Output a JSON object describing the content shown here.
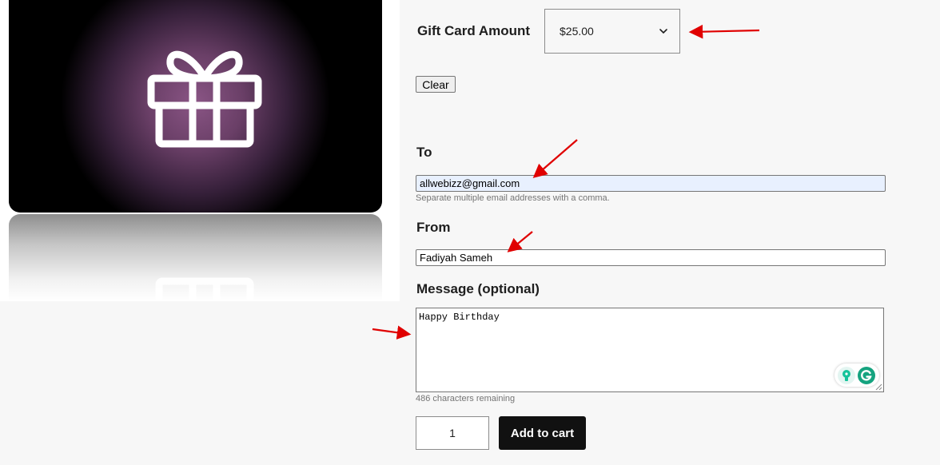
{
  "product_image": {
    "icon": "gift-icon",
    "colors": {
      "glow": "#8a5585",
      "background": "#000000"
    }
  },
  "amount": {
    "label": "Gift Card Amount",
    "selected": "$25.00",
    "clear_label": "Clear"
  },
  "to": {
    "label": "To",
    "value": "allwebizz@gmail.com",
    "hint": "Separate multiple email addresses with a comma."
  },
  "from": {
    "label": "From",
    "value": "Fadiyah Sameh"
  },
  "message": {
    "label": "Message (optional)",
    "value": "Happy Birthday",
    "remaining": "486 characters remaining"
  },
  "cart": {
    "quantity": "1",
    "add_label": "Add to cart"
  },
  "annotation_color": "#e00000"
}
